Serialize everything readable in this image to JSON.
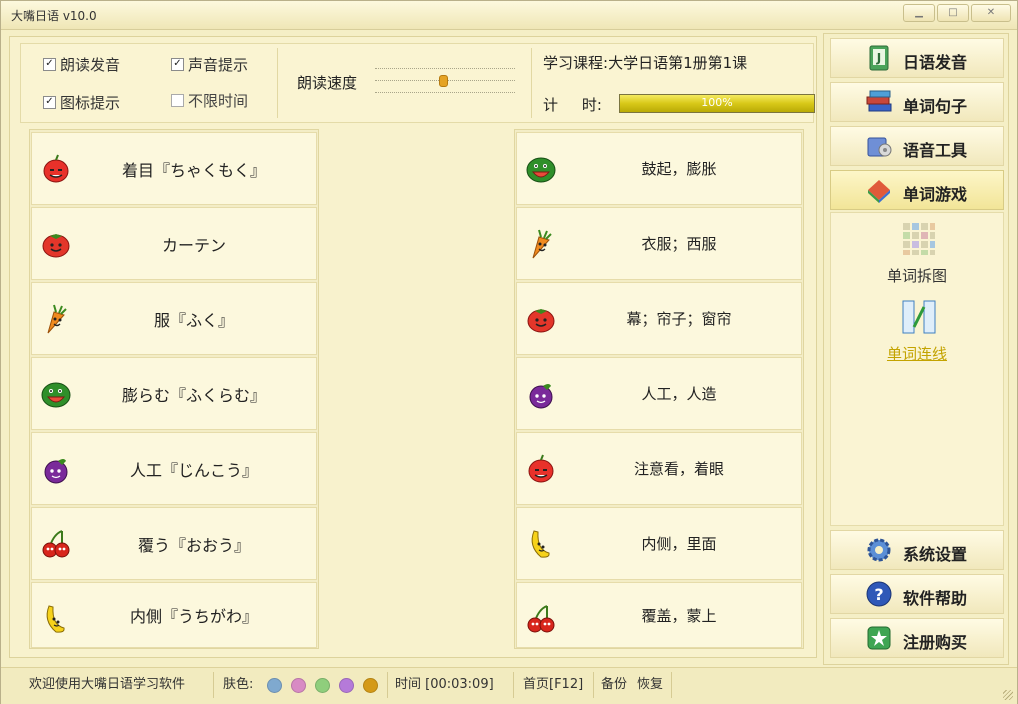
{
  "window": {
    "title": "大嘴日语 v10.0"
  },
  "options": {
    "read_aloud": {
      "label": "朗读发音",
      "checked": true
    },
    "sound_hint": {
      "label": "声音提示",
      "checked": true
    },
    "icon_hint": {
      "label": "图标提示",
      "checked": true
    },
    "unlimited_time": {
      "label": "不限时间",
      "checked": false
    },
    "speed_label": "朗读速度",
    "speed_value": 0.48
  },
  "course": {
    "label": "学习课程:",
    "value": "大学日语第1册第1课"
  },
  "timer": {
    "label": "计   时:",
    "progress_text": "100%",
    "progress": 1.0
  },
  "left_words": [
    {
      "text": "着目『ちゃくもく』",
      "icon": "apple-face-icon"
    },
    {
      "text": "カーテン",
      "icon": "tomato-face-icon"
    },
    {
      "text": "服『ふく』",
      "icon": "carrot-face-icon"
    },
    {
      "text": "膨らむ『ふくらむ』",
      "icon": "watermelon-face-icon"
    },
    {
      "text": "人工『じんこう』",
      "icon": "eggplant-face-icon"
    },
    {
      "text": "覆う『おおう』",
      "icon": "cherry-face-icon"
    },
    {
      "text": "内側『うちがわ』",
      "icon": "banana-face-icon"
    }
  ],
  "right_words": [
    {
      "text": "鼓起，膨胀",
      "icon": "watermelon-face-icon"
    },
    {
      "text": "衣服；西服",
      "icon": "carrot-face-icon"
    },
    {
      "text": "幕；帘子；窗帘",
      "icon": "tomato-face-icon"
    },
    {
      "text": "人工，人造",
      "icon": "eggplant-face-icon"
    },
    {
      "text": "注意看，着眼",
      "icon": "apple-face-icon"
    },
    {
      "text": "内侧，里面",
      "icon": "banana-face-icon"
    },
    {
      "text": "覆盖，蒙上",
      "icon": "cherry-face-icon"
    }
  ],
  "sidebar": {
    "pronunciation": "日语发音",
    "words_sentences": "单词句子",
    "voice_tools": "语音工具",
    "word_games": "单词游戏",
    "puzzle": "单词拆图",
    "matching": "单词连线",
    "settings": "系统设置",
    "help": "软件帮助",
    "register": "注册购买"
  },
  "status": {
    "welcome": "欢迎使用大嘴日语学习软件",
    "skin_label": "肤色:",
    "skin_colors": [
      "#7fa9cf",
      "#d88bc4",
      "#8fce7c",
      "#b57ad9",
      "#d49a18"
    ],
    "time": "时间 [00:03:09]",
    "home": "首页[F12]",
    "backup": "备份",
    "restore": "恢复"
  }
}
